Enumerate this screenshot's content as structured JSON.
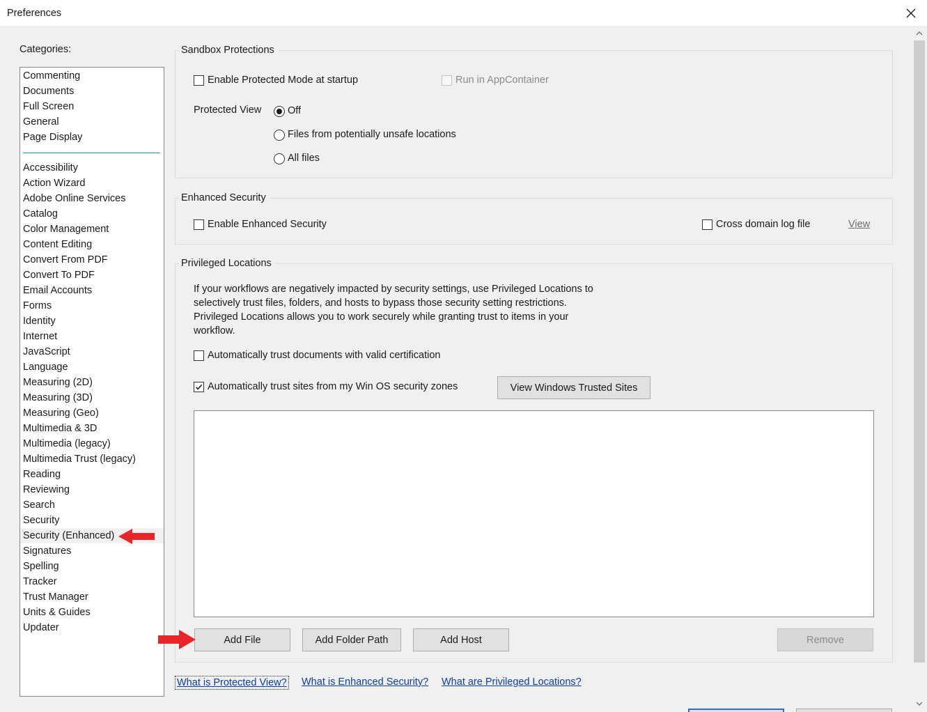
{
  "window": {
    "title": "Preferences"
  },
  "categories": {
    "label": "Categories:",
    "top_items": [
      "Commenting",
      "Documents",
      "Full Screen",
      "General",
      "Page Display"
    ],
    "items": [
      "Accessibility",
      "Action Wizard",
      "Adobe Online Services",
      "Catalog",
      "Color Management",
      "Content Editing",
      "Convert From PDF",
      "Convert To PDF",
      "Email Accounts",
      "Forms",
      "Identity",
      "Internet",
      "JavaScript",
      "Language",
      "Measuring (2D)",
      "Measuring (3D)",
      "Measuring (Geo)",
      "Multimedia & 3D",
      "Multimedia (legacy)",
      "Multimedia Trust (legacy)",
      "Reading",
      "Reviewing",
      "Search",
      "Security",
      "Security (Enhanced)",
      "Signatures",
      "Spelling",
      "Tracker",
      "Trust Manager",
      "Units & Guides",
      "Updater"
    ],
    "selected": "Security (Enhanced)"
  },
  "sandbox": {
    "title": "Sandbox Protections",
    "protected_mode": {
      "label": "Enable Protected Mode at startup",
      "checked": false
    },
    "app_container": {
      "label": "Run in AppContainer",
      "checked": false,
      "enabled": false
    },
    "protected_view_label": "Protected View",
    "options": [
      "Off",
      "Files from potentially unsafe locations",
      "All files"
    ],
    "selected": "Off"
  },
  "enhanced": {
    "title": "Enhanced Security",
    "enable": {
      "label": "Enable Enhanced Security",
      "checked": false
    },
    "cross_domain": {
      "label": "Cross domain log file",
      "checked": false
    },
    "view_link": "View"
  },
  "privileged": {
    "title": "Privileged Locations",
    "description": [
      "If your workflows are negatively impacted by security settings, use Privileged Locations to",
      "selectively trust files, folders, and hosts to bypass those security setting restrictions.",
      "Privileged Locations allows you to work securely while granting trust to items in your",
      "workflow."
    ],
    "trust_cert": {
      "label": "Automatically trust documents with valid certification",
      "checked": false
    },
    "trust_sites": {
      "label": "Automatically trust sites from my Win OS security zones",
      "checked": true
    },
    "view_sites_button": "View Windows Trusted Sites",
    "locations": [],
    "buttons": {
      "add_file": "Add File",
      "add_folder": "Add Folder Path",
      "add_host": "Add Host",
      "remove": "Remove"
    }
  },
  "links": {
    "protected_view": "What is Protected View?",
    "enhanced_security": "What is Enhanced Security?",
    "privileged_locations": "What are Privileged Locations?"
  },
  "colors": {
    "annotation_arrow": "#e8262a",
    "link": "#0a3ea8"
  }
}
